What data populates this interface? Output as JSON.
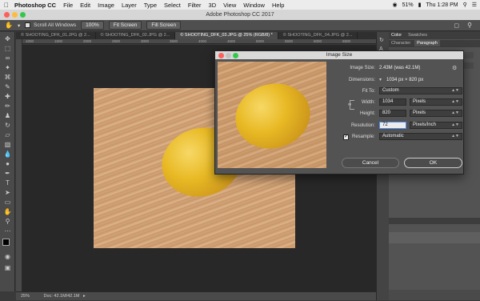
{
  "menubar": {
    "app": "Photoshop CC",
    "items": [
      "File",
      "Edit",
      "Image",
      "Layer",
      "Type",
      "Select",
      "Filter",
      "3D",
      "View",
      "Window",
      "Help"
    ],
    "battery": "51%",
    "clock": "Thu 1:28 PM"
  },
  "window": {
    "title": "Adobe Photoshop CC 2017"
  },
  "options": {
    "scroll_all": "Scroll All Windows",
    "zoom_100": "100%",
    "fit_screen": "Fit Screen",
    "fill_screen": "Fill Screen"
  },
  "tabs": [
    {
      "label": "© SHOOTING_DFK_01.JPG @ 2...",
      "active": false
    },
    {
      "label": "© SHOOTING_DFK_02.JPG @ 2...",
      "active": false
    },
    {
      "label": "© SHOOTING_DFK_03.JPG @ 25% (RGB/8) *",
      "active": true
    },
    {
      "label": "© SHOOTING_DFK_04.JPG @ 2...",
      "active": false
    }
  ],
  "ruler": [
    "1000",
    "1500",
    "2000",
    "2500",
    "3000",
    "3500",
    "4000",
    "4500",
    "5000",
    "5500",
    "6000",
    "6500"
  ],
  "status": {
    "zoom": "25%",
    "doc": "Doc: 42.1M/42.1M"
  },
  "panels": {
    "tabs_top": [
      "Color",
      "Swatches"
    ],
    "tabs_second": [
      "Character",
      "Paragraph"
    ]
  },
  "dialog": {
    "title": "Image Size",
    "image_size_label": "Image Size:",
    "image_size_value": "2.43M (was 42.1M)",
    "dimensions_label": "Dimensions:",
    "dimensions_value": "1034 px × 820 px",
    "fit_to_label": "Fit To:",
    "fit_to_value": "Custom",
    "width_label": "Width:",
    "width_value": "1034",
    "width_unit": "Pixels",
    "height_label": "Height:",
    "height_value": "820",
    "height_unit": "Pixels",
    "resolution_label": "Resolution:",
    "resolution_value": "72",
    "resolution_unit": "Pixels/Inch",
    "resample_label": "Resample:",
    "resample_value": "Automatic",
    "cancel": "Cancel",
    "ok": "OK"
  }
}
